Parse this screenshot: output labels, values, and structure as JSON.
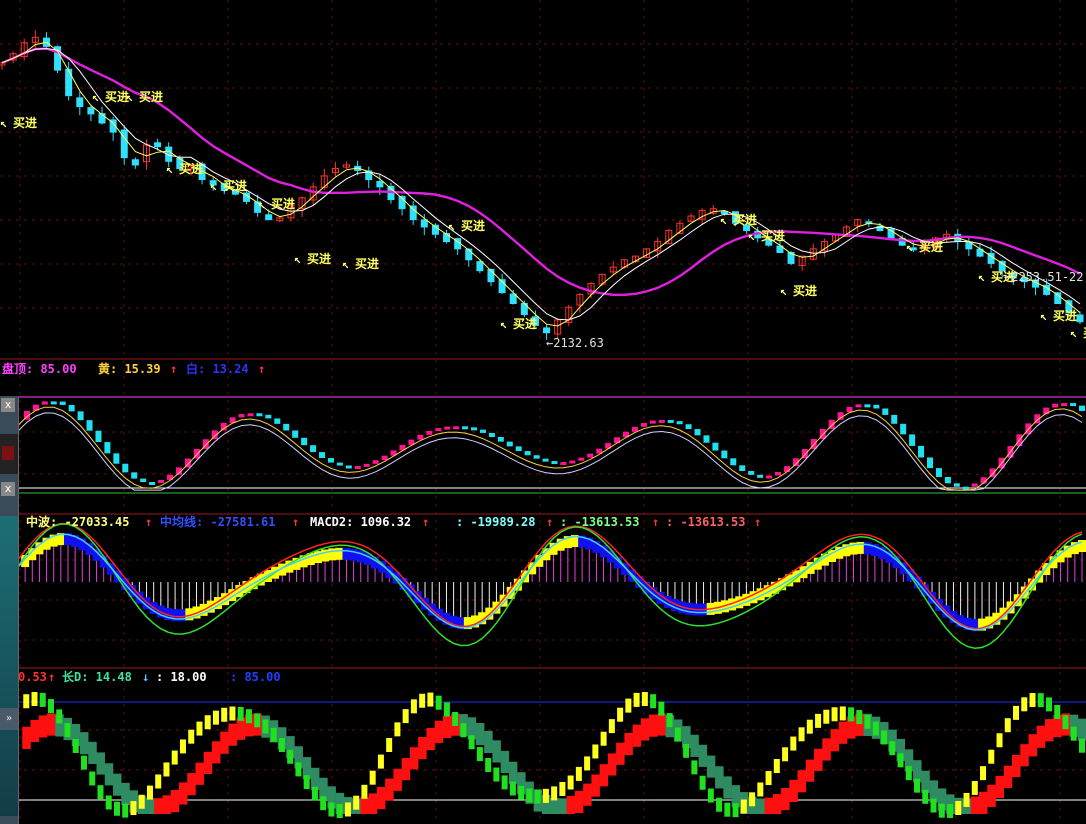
{
  "chart_data": [
    {
      "type": "candlestick",
      "panel": "price",
      "annotations": {
        "buy_label": "买进",
        "low_label": "2132.63",
        "right_label": "2253.51-22"
      },
      "ma_colors": {
        "long": "#e020e0",
        "mid": "#ffffff",
        "short": "#ffff60"
      },
      "up_color": "#ff3030",
      "down_color": "#30e0ff",
      "close": [
        2880,
        2905,
        2935,
        2950,
        2925,
        2860,
        2790,
        2760,
        2740,
        2715,
        2690,
        2620,
        2600,
        2655,
        2650,
        2610,
        2590,
        2600,
        2560,
        2545,
        2530,
        2520,
        2500,
        2470,
        2450,
        2455,
        2490,
        2510,
        2540,
        2570,
        2590,
        2600,
        2585,
        2560,
        2540,
        2505,
        2480,
        2450,
        2430,
        2410,
        2390,
        2370,
        2340,
        2310,
        2280,
        2250,
        2220,
        2190,
        2160,
        2140,
        2175,
        2210,
        2245,
        2275,
        2300,
        2320,
        2340,
        2350,
        2370,
        2390,
        2420,
        2440,
        2460,
        2475,
        2480,
        2470,
        2440,
        2420,
        2400,
        2380,
        2360,
        2330,
        2350,
        2370,
        2390,
        2410,
        2430,
        2450,
        2440,
        2420,
        2400,
        2380,
        2370,
        2380,
        2400,
        2410,
        2390,
        2370,
        2350,
        2330,
        2310,
        2290,
        2280,
        2265,
        2245,
        2220,
        2195,
        2170
      ]
    },
    {
      "type": "line",
      "panel": "oscillator-1",
      "header": {
        "label_a": "盘顶: 85.00",
        "label_b": "黄: 15.39",
        "label_c": "白: 13.24"
      },
      "header_arrows": [
        "↑",
        "↑"
      ],
      "levels": [
        85,
        15
      ]
    },
    {
      "type": "bar",
      "panel": "macd",
      "header": {
        "label_a": "中波: -27033.45",
        "label_b": "中均线: -27581.61",
        "label_c": "MACD2: 1096.32",
        "label_d": ": -19989.28",
        "label_e": ": -13613.53",
        "label_f": ": -13613.53"
      },
      "header_arrows": [
        "↑",
        "↑",
        "↑",
        "↑",
        "↑",
        "↑"
      ]
    },
    {
      "type": "area",
      "panel": "kd",
      "header": {
        "label_a": "0.53",
        "label_b": "长D: 14.48",
        "label_c": ": 18.00",
        "label_d": ": 85.00"
      },
      "header_arrows": [
        "↑",
        "↓"
      ]
    }
  ],
  "widget": {
    "close_glyph": "x",
    "scroll_glyph": "»"
  }
}
